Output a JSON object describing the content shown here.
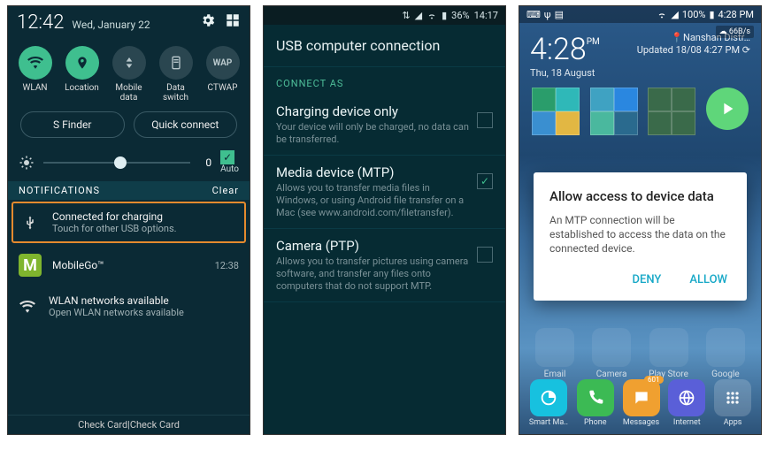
{
  "phone1": {
    "time": "12:42",
    "date": "Wed, January 22",
    "quick_settings": [
      {
        "label": "WLAN",
        "active": true,
        "icon": "wifi-icon"
      },
      {
        "label": "Location",
        "active": true,
        "icon": "location-icon"
      },
      {
        "label": "Mobile\ndata",
        "active": false,
        "icon": "mobile-data-icon"
      },
      {
        "label": "Data\nswitch",
        "active": false,
        "icon": "data-switch-icon"
      },
      {
        "label": "CTWAP",
        "active": false,
        "icon": "wap-icon",
        "text": "WAP"
      }
    ],
    "sfinder": "S Finder",
    "quick_connect": "Quick connect",
    "brightness": {
      "value_label": "0",
      "auto_label": "Auto",
      "auto_checked": true
    },
    "notifications_header": "NOTIFICATIONS",
    "clear": "Clear",
    "notifs": [
      {
        "title": "Connected for charging",
        "sub": "Touch for other USB options.",
        "icon": "usb-icon",
        "highlight": true
      },
      {
        "title": "MobileGo™",
        "sub": "",
        "icon": "mobilego-icon",
        "time": "12:38"
      },
      {
        "title": "WLAN networks available",
        "sub": "Open WLAN networks available",
        "icon": "wifi-icon"
      }
    ],
    "footer": "Check Card|Check Card"
  },
  "phone2": {
    "status_battery": "36%",
    "status_time": "14:17",
    "title": "USB computer connection",
    "connect_as": "CONNECT AS",
    "options": [
      {
        "title": "Charging device only",
        "desc": "Your device will only be charged, no data can be transferred.",
        "checked": false
      },
      {
        "title": "Media device (MTP)",
        "desc": "Allows you to transfer media files in Windows, or using Android file transfer on a Mac (see www.android.com/filetransfer).",
        "checked": true
      },
      {
        "title": "Camera (PTP)",
        "desc": "Allows you to transfer pictures using camera software, and transfer any files onto computers that do not support MTP.",
        "checked": false
      }
    ]
  },
  "phone3": {
    "status_battery": "100%",
    "status_time": "4:28 PM",
    "net_speed": "66B/s",
    "clock_time": "4:28",
    "clock_ampm": "PM",
    "clock_date": "Thu, 18 August",
    "location": "Nanshan Distr…",
    "updated": "Updated 18/08 4:27 PM",
    "dialog": {
      "title": "Allow access to device data",
      "body": "An MTP connection will be established to access the data on the connected device.",
      "deny": "DENY",
      "allow": "ALLOW"
    },
    "bg_apps": [
      {
        "label": "Email"
      },
      {
        "label": "Camera"
      },
      {
        "label": "Play Store"
      },
      {
        "label": "Google"
      }
    ],
    "dock": [
      {
        "label": "Smart Ma..",
        "color": "#17c1df"
      },
      {
        "label": "Phone",
        "color": "#3cba54"
      },
      {
        "label": "Messages",
        "color": "#f0a030",
        "badge": "601"
      },
      {
        "label": "Internet",
        "color": "#5a5fd8"
      },
      {
        "label": "Apps",
        "color": "rgba(255,255,255,0.18)"
      }
    ]
  }
}
